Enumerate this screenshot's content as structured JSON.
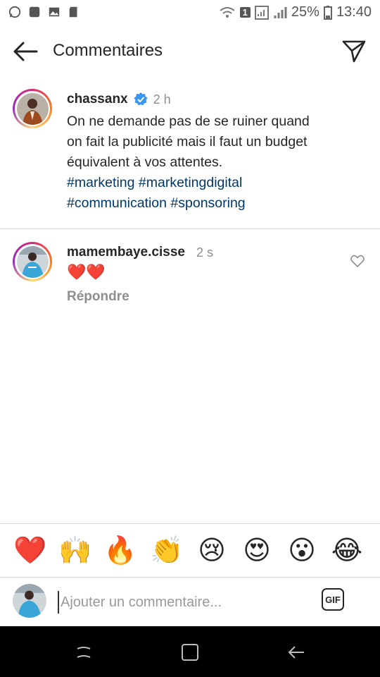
{
  "status_bar": {
    "battery": "25%",
    "time": "13:40",
    "sim_badge": "1"
  },
  "header": {
    "title": "Commentaires"
  },
  "post_caption": {
    "username": "chassanx",
    "time": "2 h",
    "text_line_1": "On ne demande pas de se ruiner quand",
    "text_line_2": "on fait la publicité mais il faut un budget",
    "text_line_3": "équivalent à vos attentes.",
    "hashtags": [
      "#marketing",
      "#marketingdigital",
      "#communication",
      "#sponsoring"
    ]
  },
  "comment": {
    "username": "mamembaye.cisse",
    "time": "2 s",
    "text": "❤️❤️",
    "reply_label": "Répondre"
  },
  "emoji_bar": [
    "❤️",
    "🙌",
    "🔥",
    "👏",
    "😢",
    "😍",
    "😮",
    "😂"
  ],
  "composer": {
    "placeholder": "Ajouter un commentaire...",
    "gif_label": "GIF"
  },
  "colors": {
    "hashtag": "#00376b",
    "verified": "#3897f0",
    "secondary_text": "#8e8e8e"
  }
}
